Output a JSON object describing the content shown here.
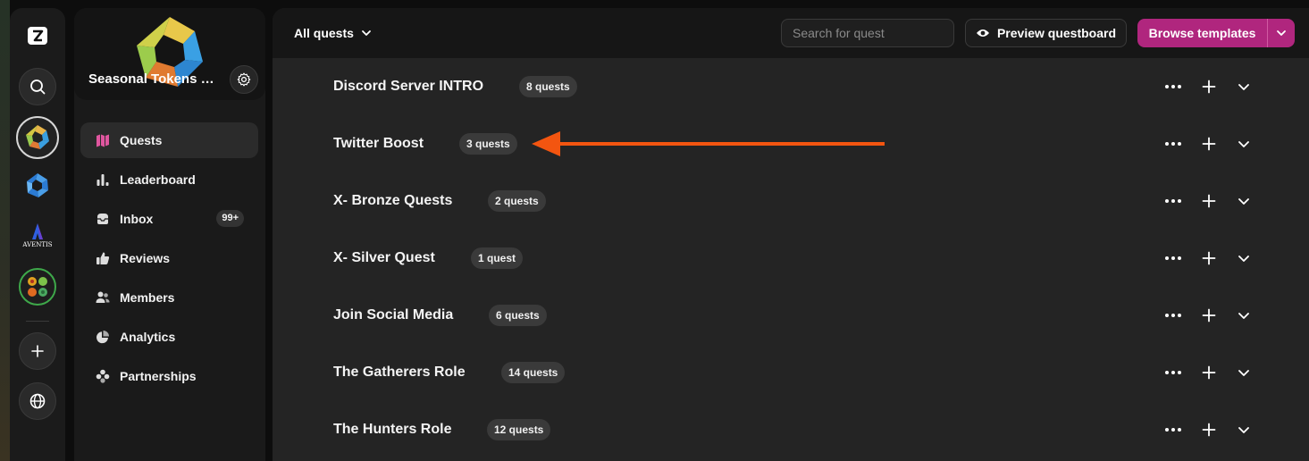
{
  "rail": {
    "items": [
      {
        "name": "app-logo",
        "label": "Z"
      },
      {
        "name": "search"
      },
      {
        "name": "seasonal-tokens-community",
        "selected": true
      },
      {
        "name": "blue-community"
      },
      {
        "name": "aventis-community",
        "label": "AVENTIS"
      },
      {
        "name": "flower-community"
      },
      {
        "name": "add-community"
      },
      {
        "name": "explore-globe"
      }
    ]
  },
  "community": {
    "name": "Seasonal Tokens Community"
  },
  "nav": {
    "items": [
      {
        "label": "Quests",
        "icon": "map-icon",
        "active": true
      },
      {
        "label": "Leaderboard",
        "icon": "bar-chart-icon"
      },
      {
        "label": "Inbox",
        "icon": "inbox-icon",
        "badge": "99+"
      },
      {
        "label": "Reviews",
        "icon": "thumbs-up-icon"
      },
      {
        "label": "Members",
        "icon": "users-icon"
      },
      {
        "label": "Analytics",
        "icon": "pie-chart-icon"
      },
      {
        "label": "Partnerships",
        "icon": "puzzle-icon"
      }
    ]
  },
  "toolbar": {
    "filter_label": "All quests",
    "search_placeholder": "Search for quest",
    "preview_label": "Preview questboard",
    "browse_label": "Browse templates"
  },
  "quests": [
    {
      "title": "Discord Server INTRO",
      "count": "8 quests"
    },
    {
      "title": "Twitter Boost",
      "count": "3 quests"
    },
    {
      "title": "X- Bronze Quests",
      "count": "2 quests"
    },
    {
      "title": "X- Silver Quest",
      "count": "1 quest"
    },
    {
      "title": "Join Social Media",
      "count": "6 quests"
    },
    {
      "title": "The Gatherers Role",
      "count": "14 quests"
    },
    {
      "title": "The Hunters Role",
      "count": "12 quests"
    }
  ],
  "colors": {
    "accent": "#b0267e",
    "quests_icon": "#e0569f",
    "arrow": "#f35510"
  }
}
